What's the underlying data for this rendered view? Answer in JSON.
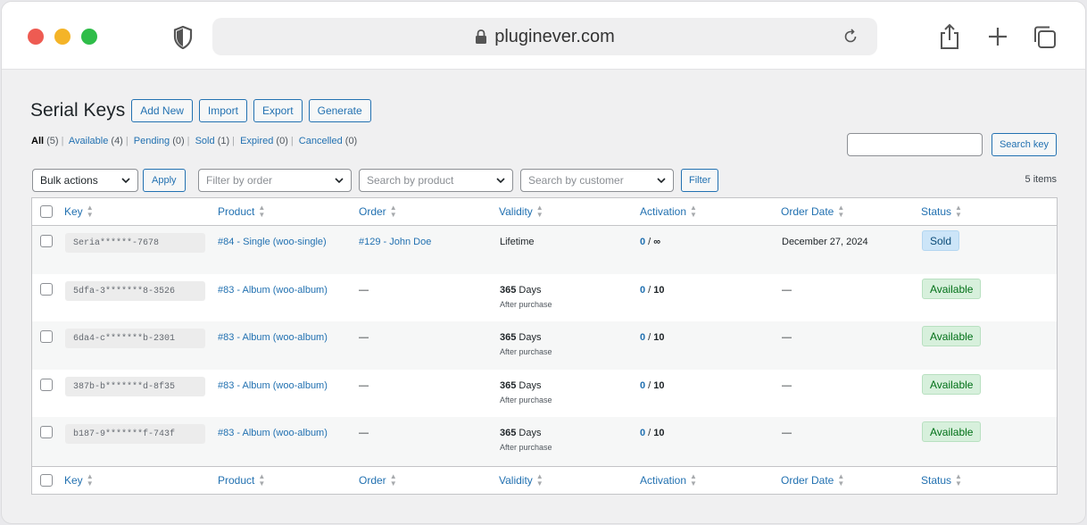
{
  "browser": {
    "url": "pluginever.com"
  },
  "page": {
    "title": "Serial Keys",
    "buttons": [
      "Add New",
      "Import",
      "Export",
      "Generate"
    ]
  },
  "filters": [
    {
      "label": "All",
      "count": "(5)"
    },
    {
      "label": "Available",
      "count": "(4)"
    },
    {
      "label": "Pending",
      "count": "(0)"
    },
    {
      "label": "Sold",
      "count": "(1)"
    },
    {
      "label": "Expired",
      "count": "(0)"
    },
    {
      "label": "Cancelled",
      "count": "(0)"
    }
  ],
  "search": {
    "value": "",
    "button": "Search key"
  },
  "tablenav": {
    "bulk_actions": "Bulk actions",
    "apply": "Apply",
    "filter_order": "Filter by order",
    "search_product": "Search by product",
    "search_customer": "Search by customer",
    "filter": "Filter",
    "items_count": "5 items"
  },
  "columns": [
    "Key",
    "Product",
    "Order",
    "Validity",
    "Activation",
    "Order Date",
    "Status"
  ],
  "rows": [
    {
      "key": "Seria******-7678",
      "product": "#84 - Single (woo-single)",
      "order": "#129 - John Doe",
      "validity_main": "Lifetime",
      "validity_num": "",
      "validity_sub": "",
      "activation_count": "0",
      "activation_limit": "∞",
      "order_date": "December 27, 2024",
      "status": "Sold"
    },
    {
      "key": "5dfa-3*******8-3526",
      "product": "#83 - Album (woo-album)",
      "order": "—",
      "validity_main": " Days",
      "validity_num": "365",
      "validity_sub": "After purchase",
      "activation_count": "0",
      "activation_limit": "10",
      "order_date": "—",
      "status": "Available"
    },
    {
      "key": "6da4-c*******b-2301",
      "product": "#83 - Album (woo-album)",
      "order": "—",
      "validity_main": " Days",
      "validity_num": "365",
      "validity_sub": "After purchase",
      "activation_count": "0",
      "activation_limit": "10",
      "order_date": "—",
      "status": "Available"
    },
    {
      "key": "387b-b*******d-8f35",
      "product": "#83 - Album (woo-album)",
      "order": "—",
      "validity_main": " Days",
      "validity_num": "365",
      "validity_sub": "After purchase",
      "activation_count": "0",
      "activation_limit": "10",
      "order_date": "—",
      "status": "Available"
    },
    {
      "key": "b187-9*******f-743f",
      "product": "#83 - Album (woo-album)",
      "order": "—",
      "validity_main": " Days",
      "validity_num": "365",
      "validity_sub": "After purchase",
      "activation_count": "0",
      "activation_limit": "10",
      "order_date": "—",
      "status": "Available"
    }
  ],
  "icons": {
    "browser_shield": "shield-icon",
    "url_lock": "lock-icon",
    "reload": "reload-icon",
    "share": "share-icon",
    "new_tab": "plus-icon",
    "tabs": "tabs-icon",
    "sort": "sort-icon",
    "select_chevron": "chevron-down-icon"
  },
  "colors": {
    "link": "#2271b1",
    "sold_badge_bg": "#cce5f8",
    "available_badge_bg": "#d7f0dc"
  }
}
